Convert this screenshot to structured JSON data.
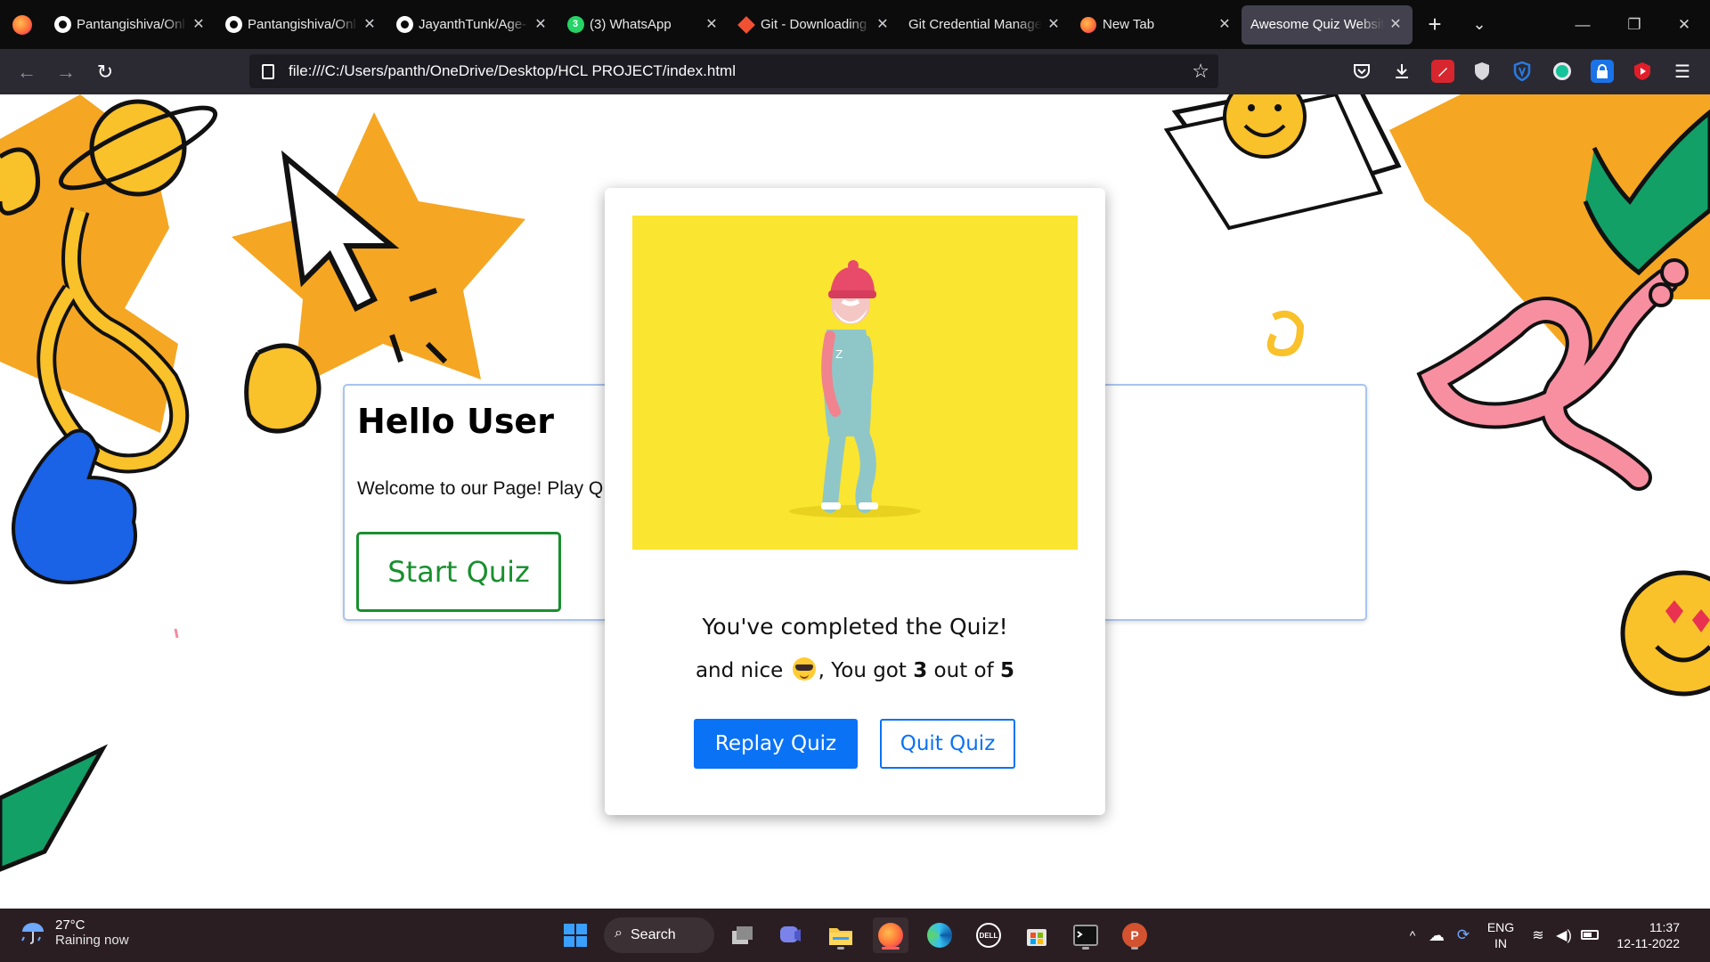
{
  "browser": {
    "tabs": [
      {
        "label": "Pantangishiva/Onl",
        "icon": "github-icon"
      },
      {
        "label": "Pantangishiva/Onl",
        "icon": "github-icon"
      },
      {
        "label": "JayanthTunk/Age-",
        "icon": "github-icon"
      },
      {
        "label": "(3) WhatsApp",
        "icon": "whatsapp-icon",
        "badge": "3"
      },
      {
        "label": "Git - Downloading",
        "icon": "git-icon"
      },
      {
        "label": "Git Credential Manage",
        "icon": ""
      },
      {
        "label": "New Tab",
        "icon": "firefox-icon"
      },
      {
        "label": "Awesome Quiz Websit",
        "icon": "",
        "active": true
      }
    ],
    "url": "file:///C:/Users/panth/OneDrive/Desktop/HCL PROJECT/index.html"
  },
  "page": {
    "card": {
      "heading": "Hello User",
      "welcome": "Welcome to our Page! Play Q",
      "start_label": "Start Quiz"
    },
    "result_modal": {
      "title": "You've completed the Quiz!",
      "score_prefix": "and nice",
      "score_middle": ", You got",
      "score_value": "3",
      "score_of": "out of",
      "score_total": "5",
      "replay_label": "Replay Quiz",
      "quit_label": "Quit Quiz"
    }
  },
  "taskbar": {
    "weather_temp": "27°C",
    "weather_condition": "Raining now",
    "search_label": "Search",
    "lang_top": "ENG",
    "lang_bottom": "IN",
    "time": "11:37",
    "date": "12-11-2022"
  }
}
